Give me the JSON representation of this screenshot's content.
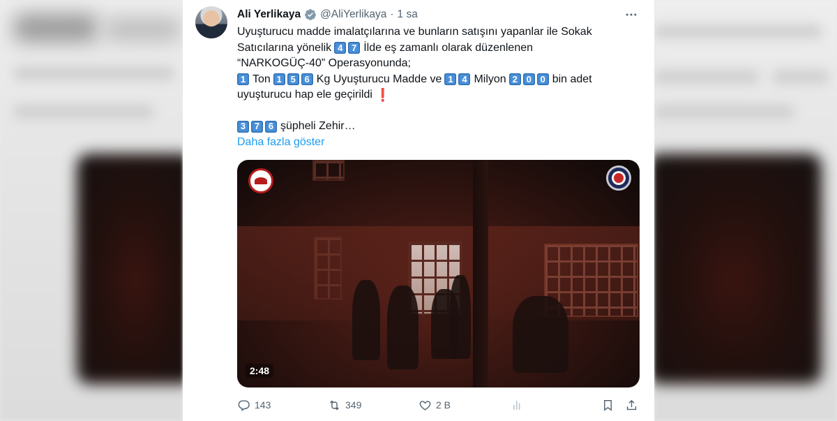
{
  "tweet": {
    "author_name": "Ali Yerlikaya",
    "handle": "@AliYerlikaya",
    "separator": "·",
    "time": "1 sa",
    "more_icon": "more-horizontal-icon",
    "verified_icon": "verified-badge-icon",
    "accent_color": "#1d9bf0",
    "keycap_color": "#4a90d9",
    "text": {
      "line1": "Uyuşturucu madde imalatçılarına ve bunların satışını yapanlar ile Sokak",
      "line2_a": "Satıcılarına yönelik",
      "line2_keycaps": [
        "4",
        "7"
      ],
      "line2_b": "İlde eş zamanlı olarak düzenlenen",
      "line3": "“NARKOGÜÇ-40” Operasyonunda;",
      "line4_k1": [
        "1"
      ],
      "line4_a": "Ton",
      "line4_k2": [
        "1",
        "5",
        "6"
      ],
      "line4_b": "Kg Uyuşturucu Madde ve",
      "line4_k3": [
        "1",
        "4"
      ],
      "line4_c": "Milyon",
      "line4_k4": [
        "2",
        "0",
        "0"
      ],
      "line4_d": "bin adet",
      "line5": "uyuşturucu hap ele geçirildi",
      "line5_emoji": "❗",
      "line6_keycaps": [
        "3",
        "7",
        "6"
      ],
      "line6_text": "şüpheli Zehir…",
      "show_more": "Daha fazla göster"
    },
    "media": {
      "duration": "2:48",
      "left_logo_icon": "jandarma-logo-icon",
      "right_logo_icon": "police-logo-icon"
    },
    "actions": {
      "reply_count": "143",
      "retweet_count": "349",
      "like_count": "2 B",
      "views_icon": "views-icon",
      "bookmark_icon": "bookmark-icon",
      "share_icon": "share-icon"
    }
  }
}
